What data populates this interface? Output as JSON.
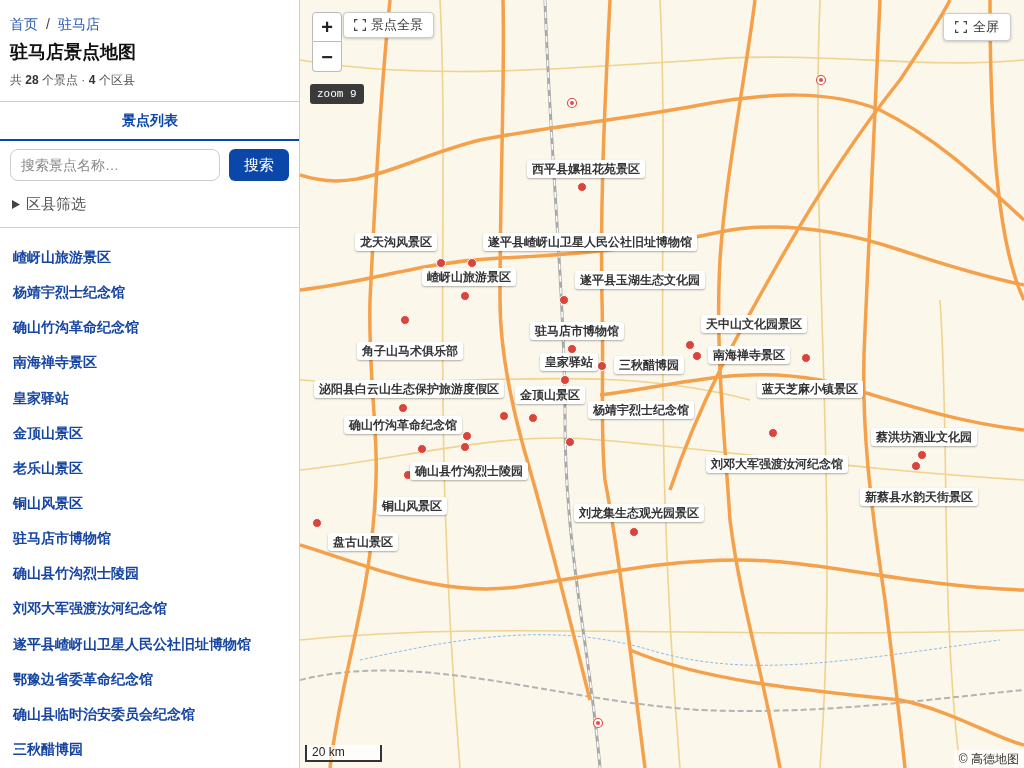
{
  "breadcrumb": {
    "items": [
      "首页",
      "驻马店"
    ],
    "separator": "/"
  },
  "title": "驻马店景点地图",
  "summary": "共 **28** 个景点 · **4** 个区县",
  "tabs": [
    {
      "label": "景点列表",
      "selected": true
    }
  ],
  "search": {
    "placeholder": "搜索景点名称…",
    "button": "搜索"
  },
  "district_filter": {
    "label": "区县筛选",
    "expanded": false
  },
  "spots": [
    "嵖岈山旅游景区",
    "杨靖宇烈士纪念馆",
    "确山竹沟革命纪念馆",
    "南海禅寺景区",
    "皇家驿站",
    "金顶山景区",
    "老乐山景区",
    "铜山风景区",
    "驻马店市博物馆",
    "确山县竹沟烈士陵园",
    "刘邓大军强渡汝河纪念馆",
    "遂平县嵖岈山卫星人民公社旧址博物馆",
    "鄂豫边省委革命纪念馆",
    "确山县临时治安委员会纪念馆",
    "三秋醋博园"
  ],
  "map": {
    "zoom_in": "+",
    "zoom_out": "−",
    "overview_button": "景点全景",
    "fullscreen_button": "全屏",
    "zoom_badge": "zoom 9",
    "scale": "20 km",
    "attribution": "© 高德地图",
    "labels": [
      "西平县嫘祖花苑景区",
      "龙天沟风景区",
      "遂平县嵖岈山卫星人民公社旧址博物馆",
      "嵖岈山旅游景区",
      "遂平县玉湖生态文化园",
      "驻马店市博物馆",
      "天中山文化园景区",
      "角子山马术俱乐部",
      "皇家驿站",
      "三秋醋博园",
      "南海禅寺景区",
      "泌阳县白云山生态保护旅游度假区",
      "金顶山景区",
      "蓝天芝麻小镇景区",
      "杨靖宇烈士纪念馆",
      "确山竹沟革命纪念馆",
      "蔡洪坊酒业文化园",
      "刘邓大军强渡汝河纪念馆",
      "确山县竹沟烈士陵园",
      "铜山风景区",
      "新蔡县水韵天街景区",
      "刘龙集生态观光园景区",
      "盘古山景区"
    ]
  }
}
